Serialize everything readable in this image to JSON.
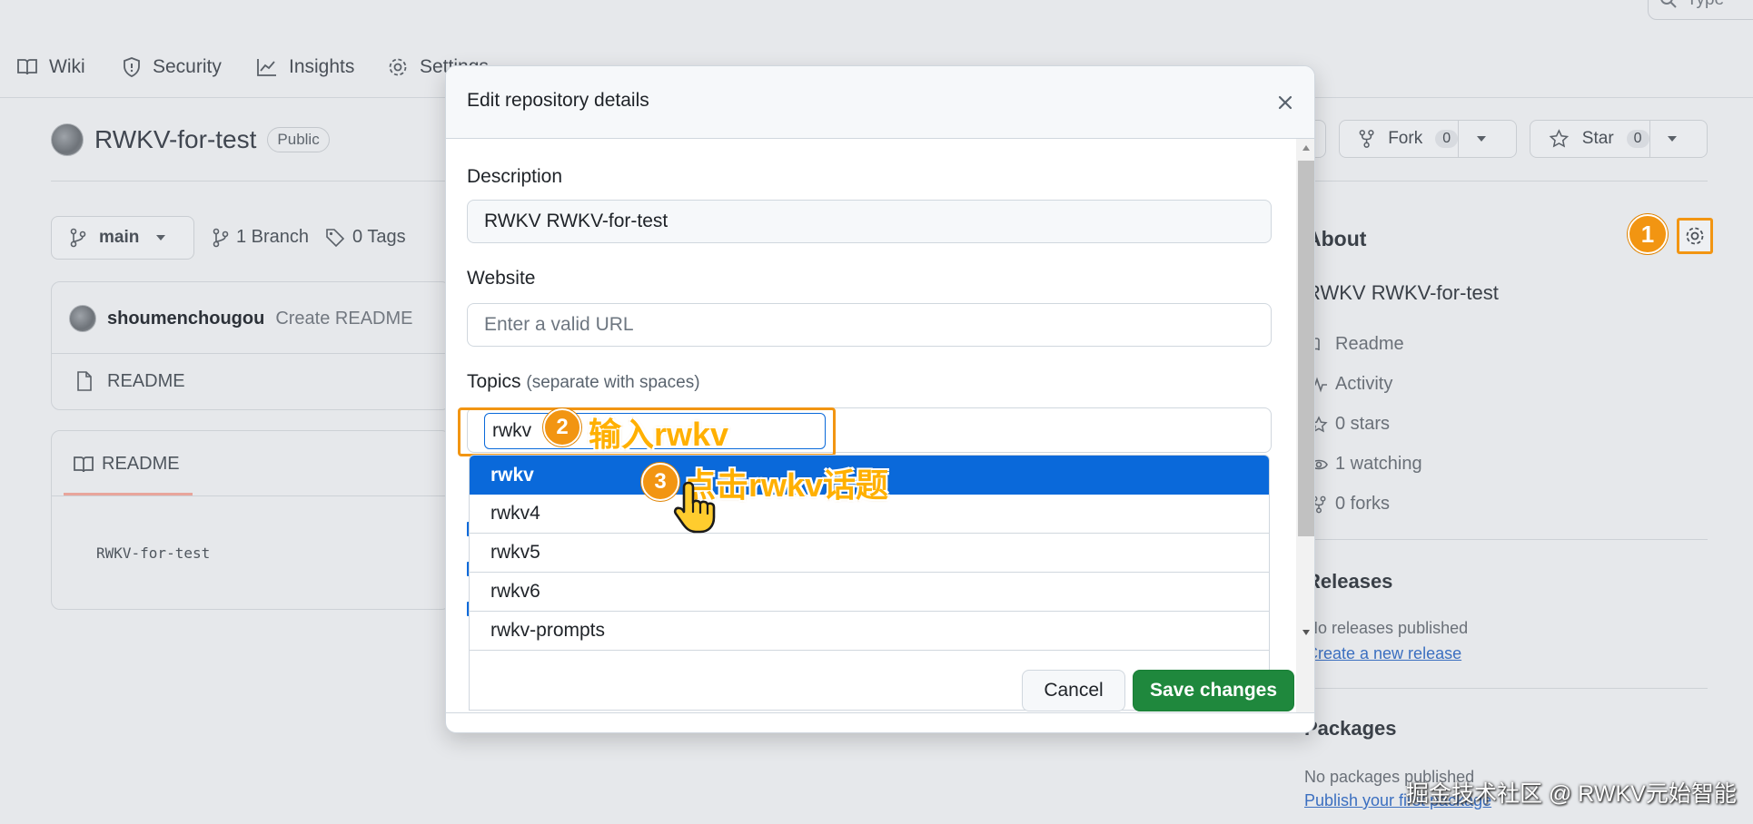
{
  "nav": {
    "tabs": [
      "Wiki",
      "Security",
      "Insights",
      "Settings"
    ],
    "search_placeholder": "Type"
  },
  "repo": {
    "name": "RWKV-for-test",
    "visibility": "Public",
    "fork_label": "Fork",
    "fork_count": "0",
    "star_label": "Star",
    "star_count": "0",
    "branch_name": "main",
    "branch_count": "1 Branch",
    "tag_count": "0 Tags"
  },
  "commit": {
    "author": "shoumenchougou",
    "message": "Create README"
  },
  "files": [
    {
      "name": "README"
    }
  ],
  "readme": {
    "tab": "README",
    "content": "RWKV-for-test"
  },
  "about": {
    "heading": "About",
    "description": "RWKV RWKV-for-test",
    "items": [
      "Readme",
      "Activity",
      "0 stars",
      "1 watching",
      "0 forks"
    ],
    "releases_heading": "Releases",
    "releases_text": "No releases published",
    "releases_link": "Create a new release",
    "packages_heading": "Packages",
    "packages_text": "No packages published",
    "packages_link": "Publish your first package"
  },
  "dialog": {
    "title": "Edit repository details",
    "description_label": "Description",
    "description_value": "RWKV RWKV-for-test",
    "website_label": "Website",
    "website_placeholder": "Enter a valid URL",
    "topics_label": "Topics",
    "topics_hint": "(separate with spaces)",
    "topic_input_value": "rwkv",
    "suggestions": [
      "rwkv",
      "rwkv4",
      "rwkv5",
      "rwkv6",
      "rwkv-prompts"
    ],
    "cancel_label": "Cancel",
    "save_label": "Save changes"
  },
  "annotations": {
    "step1_number": "1",
    "step2_number": "2",
    "step2_text": "输入rwkv",
    "step3_number": "3",
    "step3_text": "点击rwkv话题",
    "watermark": "掘金技术社区 @ RWKV元始智能"
  },
  "colors": {
    "accent_orange": "#f29512",
    "primary_blue": "#0a69da",
    "save_green": "#1f883d"
  }
}
